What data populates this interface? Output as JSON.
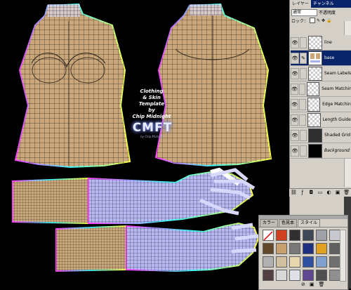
{
  "template_caption": {
    "line1": "Clothing",
    "line2": "& Skin",
    "line3": "Template",
    "line4": "by",
    "line5": "Chip Midnight"
  },
  "logo": {
    "text": "CMFT",
    "subtext": "by Chip Midnight"
  },
  "layers_panel": {
    "tabs": [
      "レイヤー",
      "チャンネル"
    ],
    "blend_mode": "通常",
    "opacity_label": "不透明度",
    "lock_label": "ロック：",
    "layers": [
      {
        "name": "line",
        "selected": false,
        "thumb": "checker"
      },
      {
        "name": "base",
        "selected": true,
        "thumb": "body"
      },
      {
        "name": "Seam Labels",
        "selected": false,
        "thumb": "checker"
      },
      {
        "name": "Seam Matching",
        "selected": false,
        "thumb": "checker"
      },
      {
        "name": "Edge Matching",
        "selected": false,
        "thumb": "checker"
      },
      {
        "name": "Length Guides",
        "selected": false,
        "thumb": "checker"
      },
      {
        "name": "Shaded Grid",
        "selected": false,
        "thumb": "dark"
      },
      {
        "name": "Background",
        "selected": false,
        "thumb": "black"
      }
    ],
    "bottom_icons": [
      "link-icon",
      "fx-icon",
      "mask-icon",
      "set-icon",
      "adjust-icon",
      "new-layer-icon",
      "trash-icon"
    ]
  },
  "styles_palette": {
    "tabs": [
      "カラー",
      "色見本",
      "スタイル"
    ],
    "active_tab": "スタイル",
    "swatches": [
      "#ffffff",
      "#d04020",
      "#303030",
      "#404858",
      "#a0a0a8",
      "#c8c8d0",
      "#604828",
      "#c8a070",
      "#787878",
      "#203080",
      "#e0a020",
      "#606060",
      "#b0b0b0",
      "#d0c0a0",
      "#e8d8b0",
      "#3050a0",
      "#80a0d0",
      "#707070",
      "#504040",
      "#d8d8d8",
      "#e0e0e8",
      "#604890",
      "#505050",
      "#909090"
    ]
  },
  "colors": {
    "body_fill": "#c9a77a",
    "grid_line": "#3a2e20",
    "arm_sleeve": "#a8b0f0",
    "panel_bg": "#d4d0c8",
    "title_blue": "#0a246a"
  }
}
